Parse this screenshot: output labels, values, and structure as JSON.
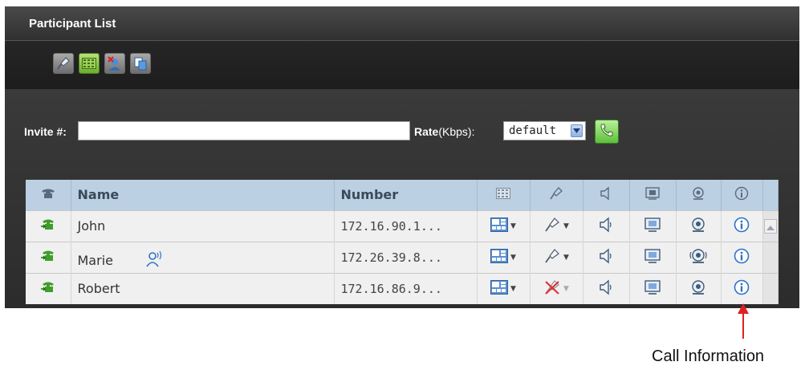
{
  "panel": {
    "title": "Participant List"
  },
  "toolbar": {
    "buttons": [
      {
        "name": "mute-all-mic-button",
        "icon": "microphone-icon"
      },
      {
        "name": "layout-button",
        "icon": "grid-layout-icon"
      },
      {
        "name": "remove-participant-button",
        "icon": "remove-user-icon"
      },
      {
        "name": "copy-button",
        "icon": "copy-icon"
      }
    ]
  },
  "invite": {
    "label": "Invite #:",
    "value": "",
    "rate_label": "Rate",
    "rate_unit": "(Kbps):",
    "rate_value": "default",
    "call_button": "phone-icon"
  },
  "table": {
    "headers": {
      "name": "Name",
      "number": "Number"
    },
    "rows": [
      {
        "name": "John",
        "number": "172.16.90.1...",
        "speaking": false,
        "mic_muted": false,
        "camera_active": false
      },
      {
        "name": "Marie",
        "number": "172.26.39.8...",
        "speaking": true,
        "mic_muted": false,
        "camera_active": true
      },
      {
        "name": "Robert",
        "number": "172.16.86.9...",
        "speaking": false,
        "mic_muted": true,
        "camera_active": false
      }
    ]
  },
  "callout": {
    "text": "Call Information",
    "color": "#e02020"
  },
  "colors": {
    "header_bg": "#bcd0e4",
    "panel_bg": "#2b2b2b",
    "accent_green": "#5ec03a"
  }
}
